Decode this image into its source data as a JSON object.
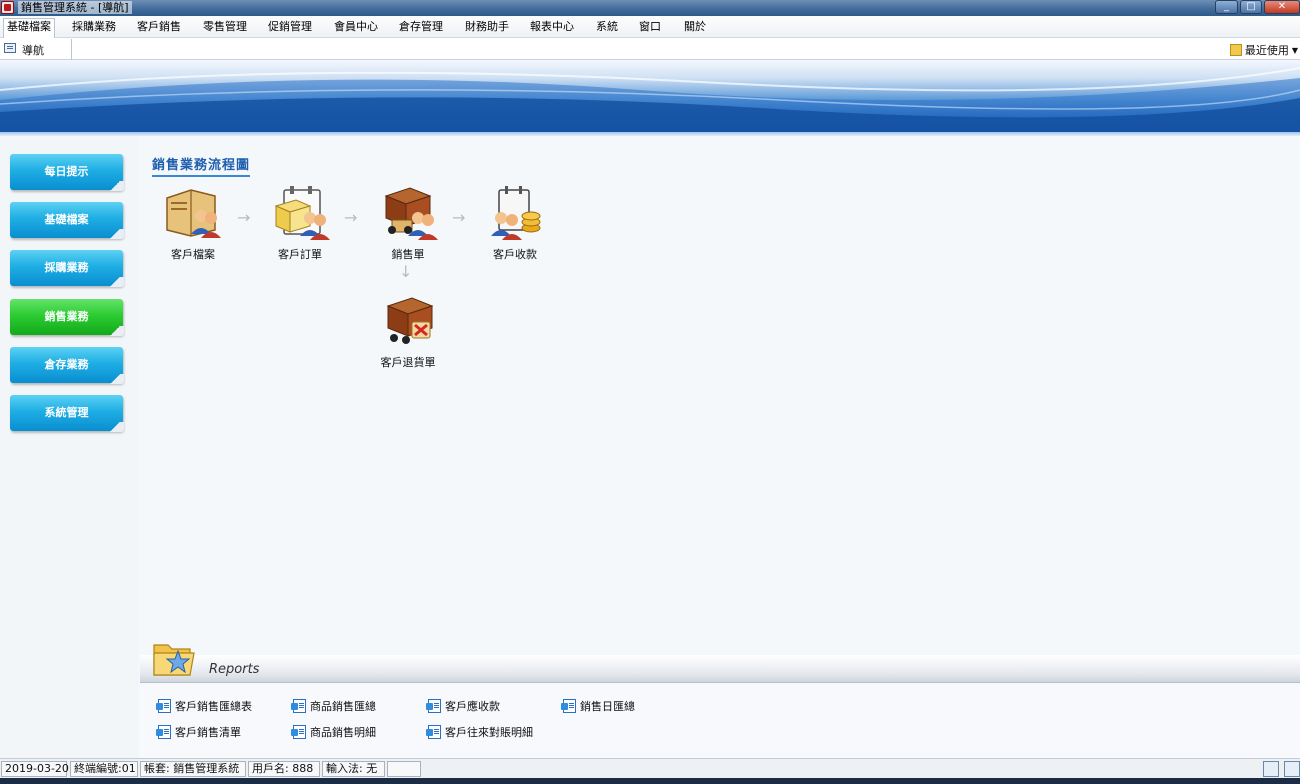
{
  "window": {
    "title": "銷售管理系統 - [導航]"
  },
  "menu": [
    "基礎檔案",
    "採購業務",
    "客戶銷售",
    "零售管理",
    "促銷管理",
    "會員中心",
    "倉存管理",
    "財務助手",
    "報表中心",
    "系統",
    "窗口",
    "關於"
  ],
  "tabs": {
    "nav": "導航",
    "recent": "最近使用"
  },
  "sidebar": [
    "每日提示",
    "基礎檔案",
    "採購業務",
    "銷售業務",
    "倉存業務",
    "系統管理"
  ],
  "sidebar_active": "銷售業務",
  "flow": {
    "title": "銷售業務流程圖",
    "nodes": [
      "客戶檔案",
      "客戶訂單",
      "銷售單",
      "客戶收款",
      "客戶退貨單"
    ]
  },
  "reports": {
    "title": "Reports",
    "links": [
      "客戶銷售匯總表",
      "商品銷售匯總",
      "客戶應收款",
      "銷售日匯總",
      "客戶銷售清單",
      "商品銷售明細",
      "客戶往來對賬明細"
    ]
  },
  "status": {
    "date": "2019-03-20",
    "terminal": "終端編號:01",
    "account": "帳套: 銷售管理系統",
    "user": "用戶名: 888",
    "ime": "輸入法: 无",
    "blank": ""
  }
}
